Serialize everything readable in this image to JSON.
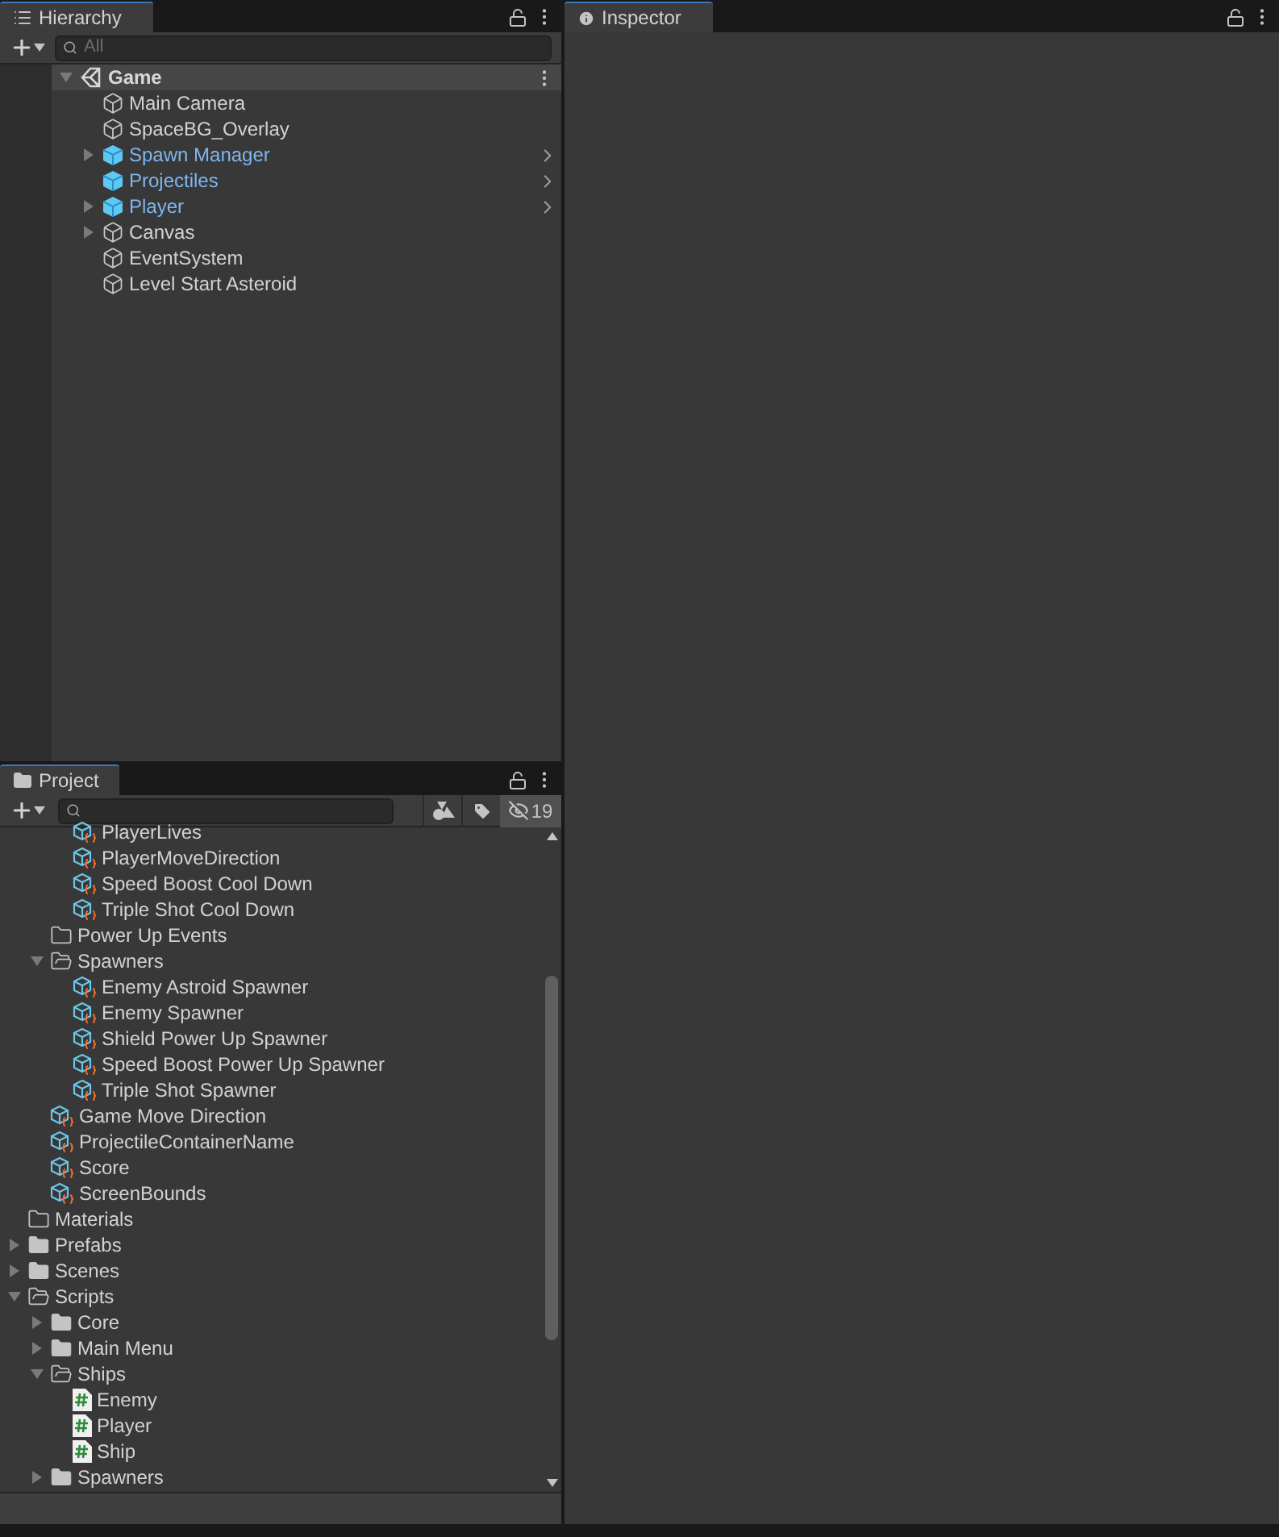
{
  "hierarchy": {
    "tab": "Hierarchy",
    "search": {
      "placeholder": "All"
    },
    "root": {
      "label": "Game",
      "expanded": true,
      "children": [
        {
          "label": "Main Camera",
          "kind": "object"
        },
        {
          "label": "SpaceBG_Overlay",
          "kind": "object"
        },
        {
          "label": "Spawn Manager",
          "kind": "prefab",
          "expanded": false
        },
        {
          "label": "Projectiles",
          "kind": "prefab"
        },
        {
          "label": "Player",
          "kind": "prefab",
          "expanded": false
        },
        {
          "label": "Canvas",
          "kind": "object",
          "expanded": false
        },
        {
          "label": "EventSystem",
          "kind": "object"
        },
        {
          "label": "Level Start Asteroid",
          "kind": "object"
        }
      ]
    }
  },
  "inspector": {
    "tab": "Inspector"
  },
  "project": {
    "tab": "Project",
    "hidden_count": "19",
    "tree": [
      {
        "children": [
          {
            "children": [
              {
                "label": "PlayerLives",
                "kind": "asset"
              },
              {
                "label": "PlayerMoveDirection",
                "kind": "asset"
              },
              {
                "label": "Speed Boost Cool Down",
                "kind": "asset"
              },
              {
                "label": "Triple Shot Cool Down",
                "kind": "asset"
              }
            ]
          },
          {
            "label": "Power Up Events",
            "kind": "empty_folder"
          },
          {
            "label": "Spawners",
            "kind": "folder",
            "expanded": true,
            "children": [
              {
                "label": "Enemy Astroid Spawner",
                "kind": "asset"
              },
              {
                "label": "Enemy Spawner",
                "kind": "asset"
              },
              {
                "label": "Shield Power Up Spawner",
                "kind": "asset"
              },
              {
                "label": "Speed Boost Power Up Spawner",
                "kind": "asset"
              },
              {
                "label": "Triple Shot Spawner",
                "kind": "asset"
              }
            ]
          },
          {
            "label": "Game Move Direction",
            "kind": "asset"
          },
          {
            "label": "ProjectileContainerName",
            "kind": "asset"
          },
          {
            "label": "Score",
            "kind": "asset"
          },
          {
            "label": "ScreenBounds",
            "kind": "asset"
          }
        ]
      },
      {
        "label": "Materials",
        "kind": "empty_folder"
      },
      {
        "label": "Prefabs",
        "kind": "folder",
        "expanded": false
      },
      {
        "label": "Scenes",
        "kind": "folder",
        "expanded": false
      },
      {
        "label": "Scripts",
        "kind": "folder",
        "expanded": true,
        "children": [
          {
            "label": "Core",
            "kind": "folder",
            "expanded": false
          },
          {
            "label": "Main Menu",
            "kind": "folder",
            "expanded": false
          },
          {
            "label": "Ships",
            "kind": "folder",
            "expanded": true,
            "children": [
              {
                "label": "Enemy",
                "kind": "script"
              },
              {
                "label": "Player",
                "kind": "script"
              },
              {
                "label": "Ship",
                "kind": "script"
              }
            ]
          },
          {
            "label": "Spawners",
            "kind": "folder",
            "expanded": false
          }
        ]
      }
    ]
  }
}
